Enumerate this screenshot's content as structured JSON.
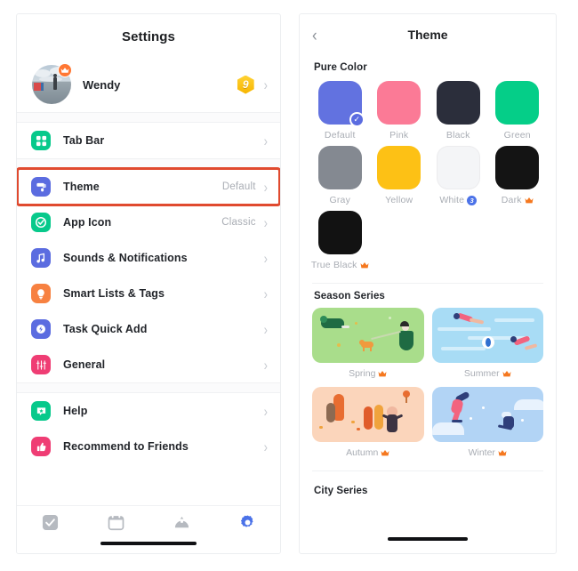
{
  "left_panel": {
    "title": "Settings",
    "profile": {
      "name": "Wendy",
      "level_badge": "9",
      "crown_icon": "crown-icon",
      "chevron": "›"
    },
    "groups": [
      {
        "items": [
          {
            "label": "Tab Bar",
            "value": "",
            "icon": "grid-icon",
            "icon_color": "#07c98b"
          }
        ]
      },
      {
        "items": [
          {
            "label": "Theme",
            "value": "Default",
            "icon": "paint-roller-icon",
            "icon_color": "#5b6ce0",
            "highlighted": true
          },
          {
            "label": "App Icon",
            "value": "Classic",
            "icon": "check-circle-icon",
            "icon_color": "#07c98b"
          },
          {
            "label": "Sounds & Notifications",
            "value": "",
            "icon": "music-note-icon",
            "icon_color": "#5b6ce0"
          },
          {
            "label": "Smart Lists & Tags",
            "value": "",
            "icon": "lightbulb-icon",
            "icon_color": "#f78141"
          },
          {
            "label": "Task Quick Add",
            "value": "",
            "icon": "sparkle-icon",
            "icon_color": "#5b6ce0"
          },
          {
            "label": "General",
            "value": "",
            "icon": "sliders-icon",
            "icon_color": "#ef3d74"
          }
        ]
      },
      {
        "items": [
          {
            "label": "Help",
            "value": "",
            "icon": "chat-star-icon",
            "icon_color": "#07c98b"
          },
          {
            "label": "Recommend to Friends",
            "value": "",
            "icon": "thumbs-up-icon",
            "icon_color": "#ef3d74"
          }
        ]
      }
    ],
    "tabbar": [
      {
        "name": "tasks-tab",
        "icon": "checkbox-icon",
        "active": false
      },
      {
        "name": "calendar-tab",
        "icon": "calendar-icon",
        "active": false
      },
      {
        "name": "pomodoro-tab",
        "icon": "pomodoro-icon",
        "active": false
      },
      {
        "name": "settings-tab",
        "icon": "gear-icon",
        "active": true
      }
    ],
    "highlight_color": "#e04a2f"
  },
  "right_panel": {
    "back_icon": "chevron-left-icon",
    "back_label": "‹",
    "title": "Theme",
    "sections": [
      {
        "title": "Pure Color",
        "swatches": [
          {
            "label": "Default",
            "color": "#6272e0",
            "selected": true,
            "badge": "",
            "crown": false
          },
          {
            "label": "Pink",
            "color": "#fb7a96",
            "selected": false,
            "badge": "",
            "crown": false
          },
          {
            "label": "Black",
            "color": "#2b2e3b",
            "selected": false,
            "badge": "",
            "crown": false
          },
          {
            "label": "Green",
            "color": "#05ce88",
            "selected": false,
            "badge": "",
            "crown": false
          },
          {
            "label": "Gray",
            "color": "#848991",
            "selected": false,
            "badge": "",
            "crown": false
          },
          {
            "label": "Yellow",
            "color": "#fdc115",
            "selected": false,
            "badge": "",
            "crown": false
          },
          {
            "label": "White",
            "color": "#f4f5f7",
            "selected": false,
            "badge": "3",
            "crown": false
          },
          {
            "label": "Dark",
            "color": "#141414",
            "selected": false,
            "badge": "",
            "crown": true
          },
          {
            "label": "True Black",
            "color": "#121212",
            "selected": false,
            "badge": "",
            "crown": true
          }
        ]
      },
      {
        "title": "Season Series",
        "themes": [
          {
            "label": "Spring",
            "art": "spring-illustration",
            "crown": true
          },
          {
            "label": "Summer",
            "art": "summer-illustration",
            "crown": true
          },
          {
            "label": "Autumn",
            "art": "autumn-illustration",
            "crown": true
          },
          {
            "label": "Winter",
            "art": "winter-illustration",
            "crown": true
          }
        ]
      },
      {
        "title": "City Series",
        "themes": []
      }
    ],
    "check_icon": "✓",
    "crown_color": "#f5781f",
    "badge_color": "#4b72e8"
  }
}
